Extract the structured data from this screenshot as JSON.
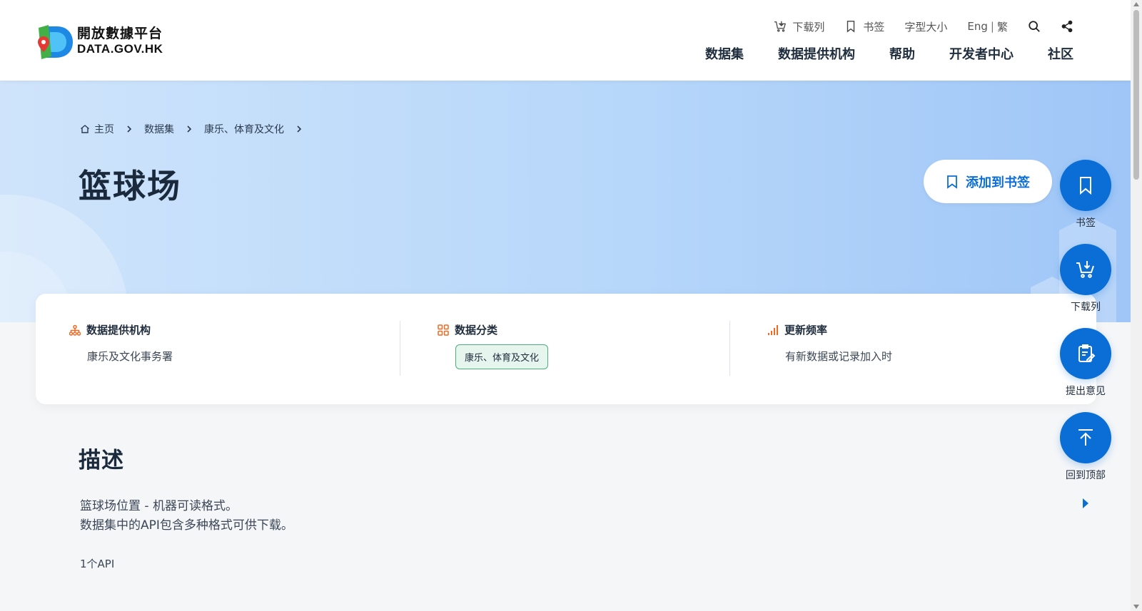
{
  "header": {
    "logo_cn": "開放數據平台",
    "logo_en": "DATA.GOV.HK",
    "util": {
      "download_list": "下载列",
      "bookmark": "书签",
      "font_size": "字型大小",
      "lang_eng": "Eng",
      "lang_sep": "|",
      "lang_trad": "繁"
    },
    "nav": [
      "数据集",
      "数据提供机构",
      "帮助",
      "开发者中心",
      "社区"
    ]
  },
  "breadcrumb": [
    "主页",
    "数据集",
    "康乐、体育及文化"
  ],
  "page_title": "篮球场",
  "bookmark_button": "添加到书签",
  "info": {
    "provider_label": "数据提供机构",
    "provider_value": "康乐及文化事务署",
    "category_label": "数据分类",
    "category_value": "康乐、体育及文化",
    "frequency_label": "更新频率",
    "frequency_value": "有新数据或记录加入时"
  },
  "description": {
    "title": "描述",
    "line1": "篮球场位置 - 机器可读格式。",
    "line2": "数据集中的API包含多种格式可供下载。",
    "api_count": "1个API"
  },
  "floating": {
    "bookmark": "书签",
    "download_list": "下载列",
    "feedback": "提出意见",
    "back_to_top": "回到顶部"
  },
  "colors": {
    "primary": "#0a6ed6",
    "accent_orange": "#f06a24",
    "tag_green": "#4bae7c"
  }
}
